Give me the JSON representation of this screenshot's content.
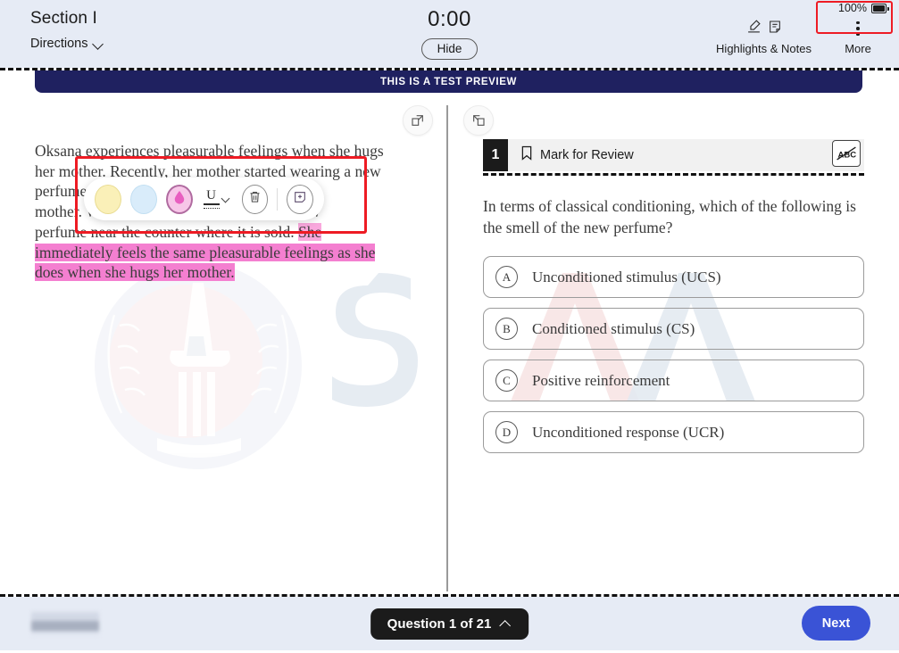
{
  "header": {
    "section_title": "Section I",
    "directions_label": "Directions",
    "timer": "0:00",
    "hide_label": "Hide",
    "highlights_notes_label": "Highlights & Notes",
    "more_label": "More",
    "battery_percent": "100%"
  },
  "banner": {
    "text": "THIS IS A TEST PREVIEW"
  },
  "passage": {
    "line1": "Oksana experiences pleasurable feelings when she hugs",
    "line2": "her mother. Recently, her mother started wearing a new",
    "line3_pre": "perfume",
    "line3_post": "ugs her",
    "line4_pre": "mother. W",
    "line4_post": "that new",
    "line5_plain": "perfume near the counter where it is sold. ",
    "line5_hl": "She",
    "line6_hl": "immediately feels the same pleasurable feelings as she",
    "line7_hl": "does when she hugs her mother."
  },
  "highlight_toolbar": {
    "colors": [
      {
        "name": "yellow",
        "hex": "#faf0b8"
      },
      {
        "name": "blue",
        "hex": "#d9ecfa"
      },
      {
        "name": "pink",
        "hex": "#f7c6e8",
        "selected": true
      }
    ],
    "underline_label": "U",
    "delete_label": "Delete",
    "note_label": "Add note"
  },
  "question": {
    "number": "1",
    "mark_for_review": "Mark for Review",
    "abc_tool": "ABC",
    "text": "In terms of classical conditioning, which of the following is the smell of the new perfume?",
    "choices": [
      {
        "letter": "A",
        "text": "Unconditioned stimulus (UCS)"
      },
      {
        "letter": "B",
        "text": "Conditioned stimulus (CS)"
      },
      {
        "letter": "C",
        "text": "Positive reinforcement"
      },
      {
        "letter": "D",
        "text": "Unconditioned response (UCR)"
      }
    ]
  },
  "footer": {
    "question_count": "Question 1 of 21",
    "next_label": "Next"
  },
  "colors": {
    "banner_navy": "#1f2160",
    "header_bg": "#e6ebf5",
    "accent_blue": "#3a53d6",
    "annotation_red": "#ee1b24",
    "highlight_pink": "#f47fd0"
  }
}
